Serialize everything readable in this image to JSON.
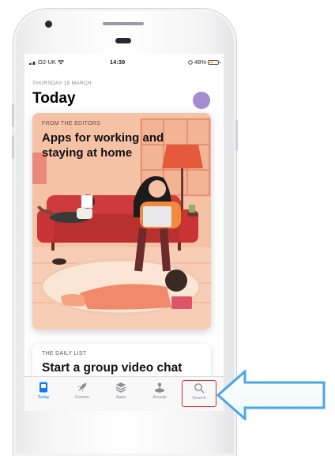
{
  "status_bar": {
    "carrier": "O2-UK",
    "time": "14:39",
    "battery": "48%",
    "battery_level": 0.48
  },
  "header": {
    "date": "THURSDAY 19 MARCH",
    "title": "Today"
  },
  "story_card": {
    "overline": "FROM THE EDITORS",
    "title": "Apps for working and staying at home"
  },
  "daily_list_card": {
    "overline": "THE DAILY LIST",
    "title": "Start a group video chat"
  },
  "tab_bar": {
    "tabs": [
      {
        "label": "Today",
        "icon": "today-icon",
        "active": true
      },
      {
        "label": "Games",
        "icon": "rocket-icon",
        "active": false
      },
      {
        "label": "Apps",
        "icon": "layers-icon",
        "active": false
      },
      {
        "label": "Arcade",
        "icon": "joystick-icon",
        "active": false
      },
      {
        "label": "Search",
        "icon": "search-icon",
        "active": false,
        "highlighted": true
      }
    ]
  },
  "colors": {
    "accent": "#1479f6",
    "highlight_box": "#d0303a",
    "annotation_arrow": "#4aa8e0",
    "card_background": "#f6c2a6",
    "avatar": "#a58bd0"
  }
}
